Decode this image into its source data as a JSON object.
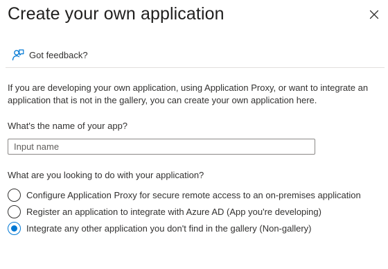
{
  "panel": {
    "title": "Create your own application",
    "close_icon": "close-icon"
  },
  "feedback": {
    "icon": "feedback-person-icon",
    "label": "Got feedback?"
  },
  "description": "If you are developing your own application, using Application Proxy, or want to integrate an application that is not in the gallery, you can create your own application here.",
  "name_question": {
    "label": "What's the name of your app?",
    "value": "",
    "placeholder": "Input name"
  },
  "purpose_question": {
    "label": "What are you looking to do with your application?",
    "options": [
      {
        "label": "Configure Application Proxy for secure remote access to an on-premises application",
        "selected": false
      },
      {
        "label": "Register an application to integrate with Azure AD (App you're developing)",
        "selected": false
      },
      {
        "label": "Integrate any other application you don't find in the gallery (Non-gallery)",
        "selected": true
      }
    ]
  },
  "colors": {
    "accent": "#0078d4",
    "text": "#323130",
    "divider": "#e1dfdd",
    "input_border": "#8a8886"
  }
}
